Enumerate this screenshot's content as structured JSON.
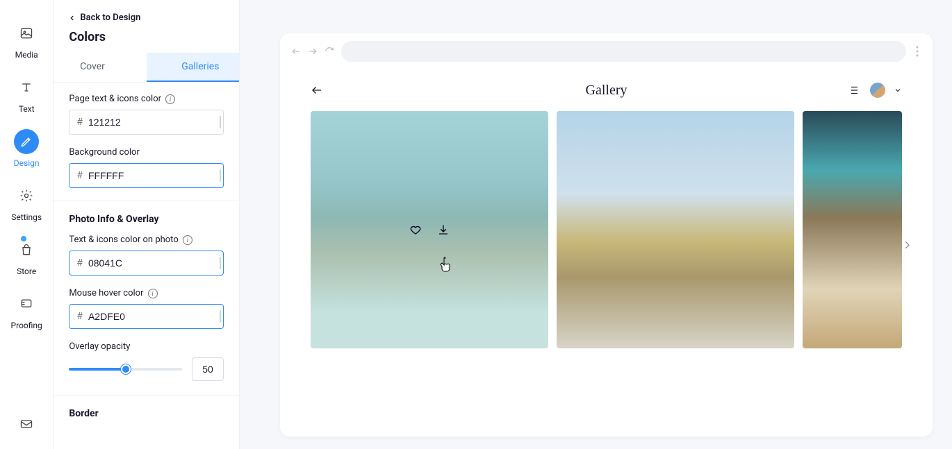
{
  "rail": {
    "media": "Media",
    "text": "Text",
    "design": "Design",
    "settings": "Settings",
    "store": "Store",
    "proofing": "Proofing"
  },
  "panel": {
    "back": "Back to Design",
    "title": "Colors",
    "tabs": {
      "cover": "Cover",
      "galleries": "Galleries"
    },
    "page_text_label": "Page text & icons color",
    "page_text_value": "121212",
    "page_text_swatch": "#121212",
    "background_label": "Background color",
    "background_value": "FFFFFF",
    "background_swatch": "#FFFFFF",
    "photo_section": "Photo Info & Overlay",
    "text_on_photo_label": "Text & icons color on photo",
    "text_on_photo_value": "08041C",
    "text_on_photo_swatch": "#08041C",
    "hover_label": "Mouse hover color",
    "hover_value": "A2DFE0",
    "hover_swatch": "#A2DFE0",
    "opacity_label": "Overlay opacity",
    "opacity_value": "50",
    "border_section": "Border"
  },
  "preview": {
    "gallery_title": "Gallery"
  }
}
